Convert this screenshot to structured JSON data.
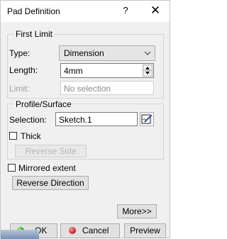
{
  "window": {
    "title": "Pad Definition",
    "help_glyph": "?",
    "close_glyph": "✕"
  },
  "first_limit": {
    "group_label": "First Limit",
    "type_label": "Type:",
    "type_value": "Dimension",
    "length_label": "Length:",
    "length_value": "4mm",
    "limit_label": "Limit:",
    "limit_value": "No selection"
  },
  "profile_surface": {
    "group_label": "Profile/Surface",
    "selection_label": "Selection:",
    "selection_value": "Sketch.1",
    "thick_label": "Thick",
    "thick_checked": false,
    "reverse_side_label": "Reverse Side"
  },
  "mirrored_extent_label": "Mirrored extent",
  "mirrored_extent_checked": false,
  "reverse_direction_label": "Reverse Direction",
  "more_label": "More>>",
  "footer": {
    "ok_label": "OK",
    "cancel_label": "Cancel",
    "preview_label": "Preview"
  }
}
